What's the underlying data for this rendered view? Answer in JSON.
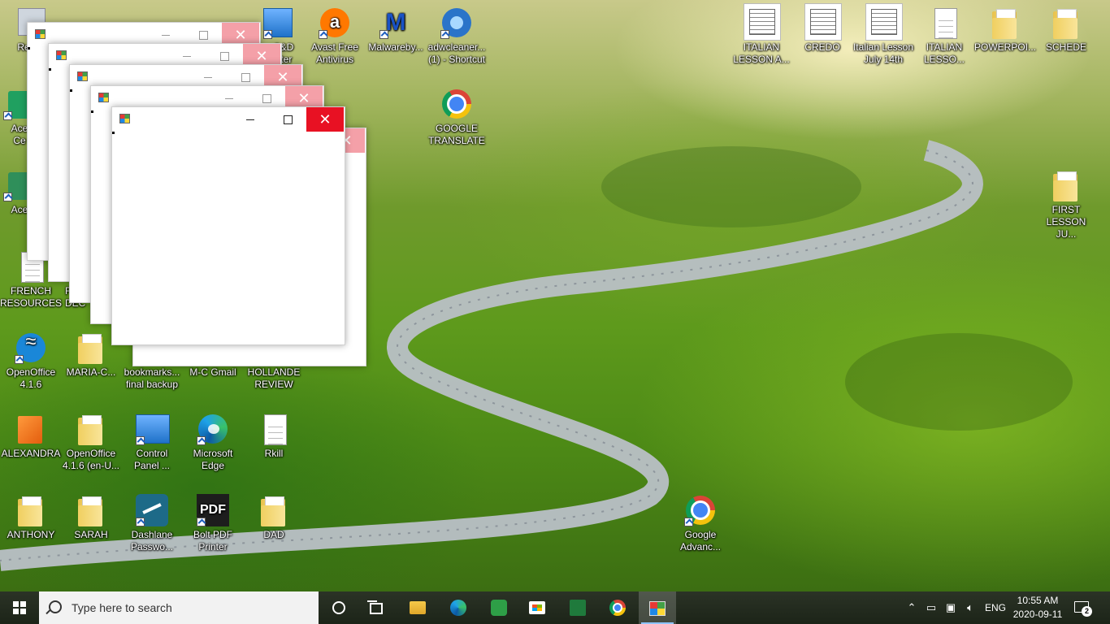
{
  "desktop": {
    "icons": [
      {
        "id": "recycle",
        "label": "Recycle Bin",
        "shown": "Recyc"
      },
      {
        "id": "acer-care",
        "label": "Acer Care Center",
        "shown1": "Ace",
        "shown2": "Ce"
      },
      {
        "id": "acer2",
        "label": "Acer",
        "shown": "Ace"
      },
      {
        "id": "french",
        "line1": "FRENCH",
        "line2": "RESOURCES"
      },
      {
        "id": "dec",
        "line1": "F",
        "line2": "DEC"
      },
      {
        "id": "openoffice",
        "line1": "OpenOffice",
        "line2": "4.1.6"
      },
      {
        "id": "maria",
        "line1": "MARIA-C..."
      },
      {
        "id": "bookmarks",
        "line1": "bookmarks...",
        "line2": "final backup"
      },
      {
        "id": "mcgmail",
        "line1": "M-C Gmail"
      },
      {
        "id": "hollande",
        "line1": "HOLLANDE",
        "line2": "REVIEW"
      },
      {
        "id": "alexandra",
        "line1": "ALEXANDRA"
      },
      {
        "id": "openoffice-en",
        "line1": "OpenOffice",
        "line2": "4.1.6 (en-U..."
      },
      {
        "id": "controlpanel",
        "line1": "Control",
        "line2": "Panel ..."
      },
      {
        "id": "msedge",
        "line1": "Microsoft",
        "line2": "Edge"
      },
      {
        "id": "rkill",
        "line1": "Rkill"
      },
      {
        "id": "anthony",
        "line1": "ANTHONY"
      },
      {
        "id": "sarah",
        "line1": "SARAH"
      },
      {
        "id": "dashlane",
        "line1": "Dashlane",
        "line2": "Passwo..."
      },
      {
        "id": "boltpdf",
        "line1": "Bolt PDF",
        "line2": "Printer"
      },
      {
        "id": "dad",
        "line1": "DAD"
      },
      {
        "id": "sd",
        "line1": "S&D",
        "line2": "nter"
      },
      {
        "id": "avast",
        "line1": "Avast Free",
        "line2": "Antivirus"
      },
      {
        "id": "malwarebytes",
        "line1": "Malwareby..."
      },
      {
        "id": "adwcleaner",
        "line1": "adwcleaner...",
        "line2": "(1) - Shortcut"
      },
      {
        "id": "google-translate",
        "line1": "GOOGLE",
        "line2": "TRANSLATE"
      },
      {
        "id": "google-advanced",
        "line1": "Google",
        "line2": "Advanc..."
      },
      {
        "id": "italian-lesson-a",
        "line1": "ITALIAN",
        "line2": "LESSON A..."
      },
      {
        "id": "credo",
        "line1": "CREDO"
      },
      {
        "id": "italian-july",
        "line1": "Italian Lesson",
        "line2": "July 14th"
      },
      {
        "id": "italian-lesso",
        "line1": "ITALIAN",
        "line2": "LESSO..."
      },
      {
        "id": "powerpoi",
        "line1": "POWERPOI..."
      },
      {
        "id": "schede",
        "line1": "SCHEDE"
      },
      {
        "id": "first-lesson",
        "line1": "FIRST",
        "line2": "LESSON JU..."
      }
    ]
  },
  "windows": {
    "close_glyph": "✕"
  },
  "taskbar": {
    "search_placeholder": "Type here to search",
    "language": "ENG",
    "time": "10:55 AM",
    "date": "2020-09-11",
    "notification_count": "2",
    "pinned": [
      "cortana-icon",
      "task-view-icon",
      "file-explorer-icon",
      "edge-icon",
      "green-app-icon",
      "store-icon",
      "sheets-icon",
      "chrome-icon",
      "app-window-icon"
    ]
  },
  "colors": {
    "close_active": "#e81123",
    "close_inactive": "#f4a0a8",
    "taskbar": "#1f2a20"
  }
}
